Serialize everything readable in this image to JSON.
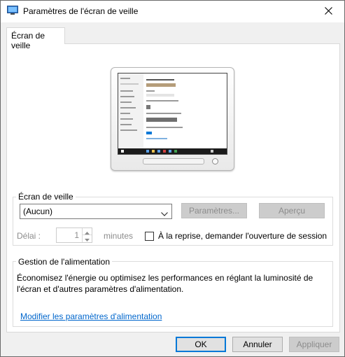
{
  "window": {
    "title": "Paramètres de l'écran de veille",
    "icon": "screensaver-monitor-icon",
    "close_icon": "close-icon"
  },
  "tab": {
    "label": "Écran de veille"
  },
  "screensaver_group": {
    "legend": "Écran de veille",
    "selected": "(Aucun)",
    "settings_button": "Paramètres...",
    "preview_button": "Aperçu",
    "delay_label": "Délai :",
    "delay_value": "1",
    "delay_unit": "minutes",
    "resume_label": "À la reprise, demander l'ouverture de session",
    "resume_checked": false
  },
  "power_group": {
    "legend": "Gestion de l'alimentation",
    "description": "Économisez l'énergie ou optimisez les performances en réglant la luminosité de l'écran et d'autres paramètres d'alimentation.",
    "link": "Modifier les paramètres d'alimentation"
  },
  "footer": {
    "ok": "OK",
    "cancel": "Annuler",
    "apply": "Appliquer"
  },
  "colors": {
    "accent": "#0078d7",
    "link": "#0066cc",
    "disabled_text": "#8c8c8c",
    "dialog_bg": "#f0f0f0"
  }
}
